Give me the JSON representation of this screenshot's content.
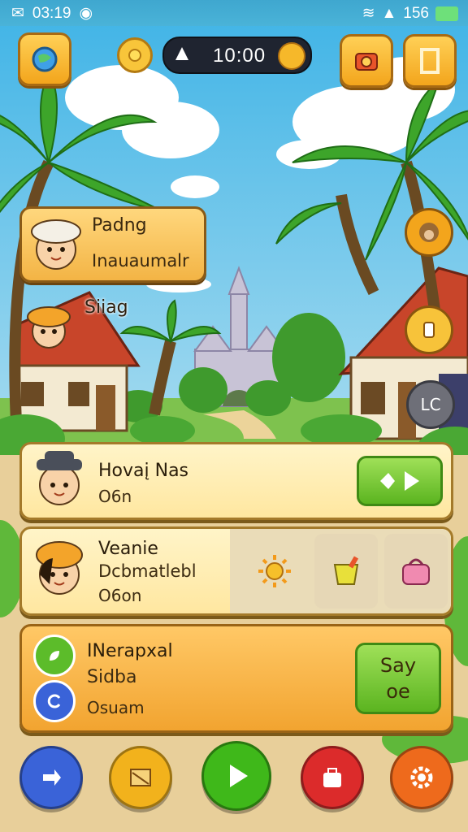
{
  "status_bar": {
    "time": "03:19",
    "battery": "156"
  },
  "hud": {
    "timer": "10:00"
  },
  "bubble": {
    "line1": "Padng",
    "line2": "Inauaumalr"
  },
  "side_label": "Siiag",
  "floating_badge": "LC",
  "cards": [
    {
      "title": "Hovaį Nas",
      "subtitle": "O6n"
    },
    {
      "title": "Veanie",
      "subtitle": "Dcbmatlebl",
      "extra": "O6on"
    },
    {
      "title": "INerapxal",
      "subtitle": "Sidba",
      "extra": "Osuam",
      "button_line1": "Say",
      "button_line2": "oe"
    }
  ],
  "colors": {
    "accent_yellow": "#f3a51c",
    "accent_green": "#5bb420",
    "nav_blue": "#3a63d8",
    "nav_yellow": "#f2b21c",
    "nav_green": "#3fb81a",
    "nav_red": "#dc2b2b",
    "nav_orange": "#ee6a1c"
  },
  "icons": {
    "top_left": "map-icon",
    "coin": "sun-coin-icon",
    "camera": "camera-icon",
    "door": "door-icon",
    "nav": [
      "arrow-icon",
      "map-icon",
      "play-icon",
      "bag-icon",
      "settings-icon"
    ]
  }
}
